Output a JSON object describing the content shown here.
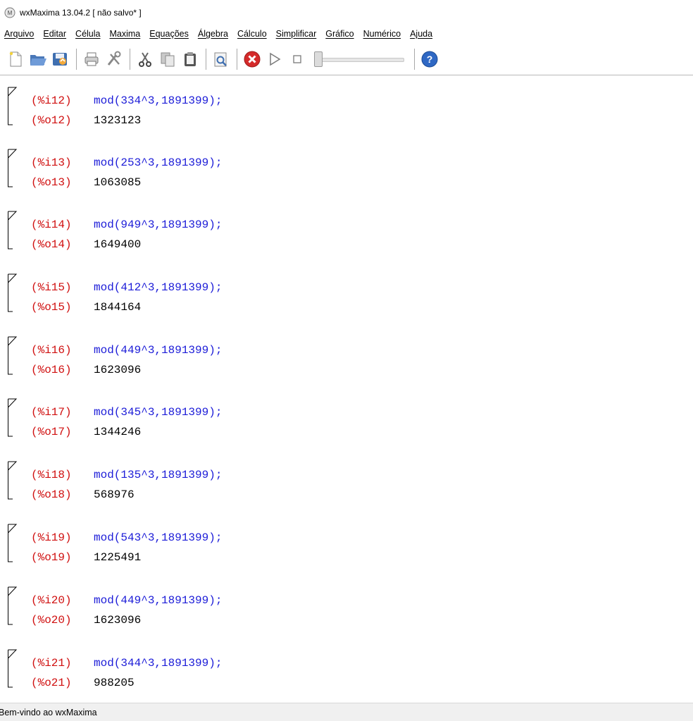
{
  "window": {
    "title": "wxMaxima 13.04.2 [ não salvo* ]"
  },
  "menu": {
    "items": [
      "Arquivo",
      "Editar",
      "Célula",
      "Maxima",
      "Equações",
      "Álgebra",
      "Cálculo",
      "Simplificar",
      "Gráfico",
      "Numérico",
      "Ajuda"
    ]
  },
  "toolbar": {
    "icons": [
      "new-document-icon",
      "open-folder-icon",
      "save-icon",
      "print-icon",
      "preferences-icon",
      "cut-icon",
      "copy-icon",
      "paste-icon",
      "find-icon",
      "interrupt-icon",
      "play-animation-icon",
      "stop-animation-icon",
      "animation-slider",
      "help-icon"
    ]
  },
  "cells": [
    {
      "in_label": "(%i12)",
      "in_code": "mod(334^3,1891399);",
      "out_label": "(%o12)",
      "out_value": "1323123"
    },
    {
      "in_label": "(%i13)",
      "in_code": "mod(253^3,1891399);",
      "out_label": "(%o13)",
      "out_value": "1063085"
    },
    {
      "in_label": "(%i14)",
      "in_code": "mod(949^3,1891399);",
      "out_label": "(%o14)",
      "out_value": "1649400"
    },
    {
      "in_label": "(%i15)",
      "in_code": "mod(412^3,1891399);",
      "out_label": "(%o15)",
      "out_value": "1844164"
    },
    {
      "in_label": "(%i16)",
      "in_code": "mod(449^3,1891399);",
      "out_label": "(%o16)",
      "out_value": "1623096"
    },
    {
      "in_label": "(%i17)",
      "in_code": "mod(345^3,1891399);",
      "out_label": "(%o17)",
      "out_value": "1344246"
    },
    {
      "in_label": "(%i18)",
      "in_code": "mod(135^3,1891399);",
      "out_label": "(%o18)",
      "out_value": "568976"
    },
    {
      "in_label": "(%i19)",
      "in_code": "mod(543^3,1891399);",
      "out_label": "(%o19)",
      "out_value": "1225491"
    },
    {
      "in_label": "(%i20)",
      "in_code": "mod(449^3,1891399);",
      "out_label": "(%o20)",
      "out_value": "1623096"
    },
    {
      "in_label": "(%i21)",
      "in_code": "mod(344^3,1891399);",
      "out_label": "(%o21)",
      "out_value": "988205"
    }
  ],
  "status": {
    "text": "Bem-vindo ao wxMaxima"
  },
  "colors": {
    "input_label": "#d01010",
    "input_code": "#1c1cd8",
    "output_value": "#000000"
  }
}
